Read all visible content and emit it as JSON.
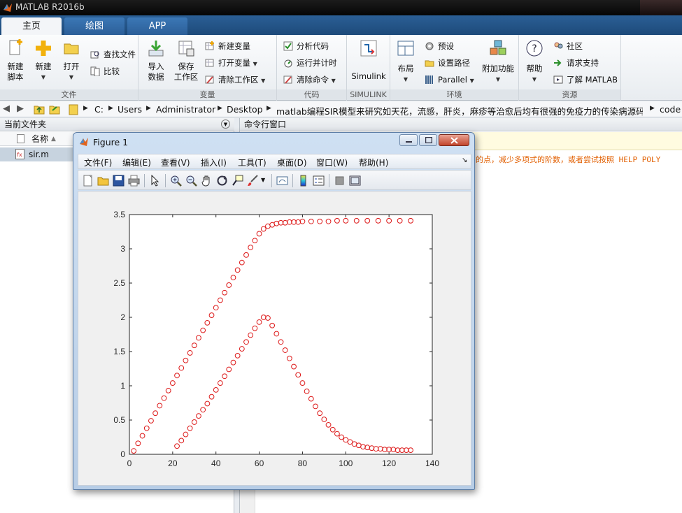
{
  "app": {
    "title": "MATLAB R2016b"
  },
  "tabs": [
    {
      "label": "主页",
      "active": true
    },
    {
      "label": "绘图",
      "active": false
    },
    {
      "label": "APP",
      "active": false
    }
  ],
  "ribbon": {
    "file_group": {
      "label": "文件",
      "new_script": "新建\n脚本",
      "new": "新建",
      "open": "打开",
      "find_files": "查找文件",
      "compare": "比较"
    },
    "variable_group": {
      "label": "变量",
      "import_data": "导入\n数据",
      "save_workspace": "保存\n工作区",
      "new_variable": "新建变量",
      "open_variable": "打开变量",
      "clear_workspace": "清除工作区"
    },
    "code_group": {
      "label": "代码",
      "analyze_code": "分析代码",
      "run_and_time": "运行并计时",
      "clear_commands": "清除命令"
    },
    "simulink_group": {
      "label": "SIMULINK",
      "simulink": "Simulink"
    },
    "env_group": {
      "label": "环境",
      "layout": "布局",
      "preferences": "预设",
      "set_path": "设置路径",
      "parallel": "Parallel",
      "addons": "附加功能"
    },
    "resources_group": {
      "label": "资源",
      "help": "帮助",
      "community": "社区",
      "request_support": "请求支持",
      "learn_matlab": "了解 MATLAB"
    }
  },
  "address": {
    "crumbs": [
      "C:",
      "Users",
      "Administrator",
      "Desktop",
      "matlab编程SIR模型来研究如天花，流感，肝炎，麻疹等治愈后均有很强的免疫力的传染病源码程序",
      "code"
    ]
  },
  "left_panel": {
    "title": "当前文件夹",
    "column_name": "名称",
    "sort_indicator": "▲",
    "files": [
      "sir.m"
    ]
  },
  "right_panel": {
    "title": "命令行窗口",
    "warning_text": "的点，减少多项式的阶数，或者尝试按照 HELP POLY"
  },
  "figure": {
    "title": "Figure 1",
    "menus": [
      "文件(F)",
      "编辑(E)",
      "查看(V)",
      "插入(I)",
      "工具(T)",
      "桌面(D)",
      "窗口(W)",
      "帮助(H)"
    ],
    "toolbar_icons": [
      "new-figure-icon",
      "open-file-icon",
      "save-icon",
      "print-icon",
      "select-arrow-icon",
      "zoom-in-icon",
      "zoom-out-icon",
      "pan-hand-icon",
      "rotate-3d-icon",
      "data-cursor-icon",
      "brush-icon",
      "link-plot-icon",
      "colorbar-icon",
      "legend-icon",
      "hide-tools-icon",
      "show-tools-icon"
    ]
  },
  "chart_data": {
    "type": "scatter",
    "marker": "circle",
    "color": "#dd1a1a",
    "xlim": [
      0,
      140
    ],
    "ylim": [
      0,
      3.5
    ],
    "xticks": [
      0,
      20,
      40,
      60,
      80,
      100,
      120,
      140
    ],
    "yticks": [
      0,
      0.5,
      1,
      1.5,
      2,
      2.5,
      3,
      3.5
    ],
    "series": [
      {
        "x": [
          2,
          4,
          6,
          8,
          10,
          12,
          14,
          16,
          18,
          20,
          22,
          24,
          26,
          28,
          30,
          32,
          34,
          36,
          38,
          40,
          42,
          44,
          46,
          48,
          50,
          52,
          54,
          56,
          58,
          60,
          62,
          64,
          66,
          68,
          70,
          72,
          74,
          76,
          78,
          80,
          84,
          88,
          92,
          96,
          100,
          105,
          110,
          115,
          120,
          125,
          130
        ],
        "y": [
          0.05,
          0.16,
          0.27,
          0.38,
          0.49,
          0.6,
          0.71,
          0.82,
          0.93,
          1.04,
          1.15,
          1.26,
          1.37,
          1.48,
          1.59,
          1.7,
          1.81,
          1.92,
          2.03,
          2.14,
          2.25,
          2.36,
          2.47,
          2.58,
          2.69,
          2.8,
          2.91,
          3.02,
          3.12,
          3.22,
          3.29,
          3.33,
          3.35,
          3.37,
          3.38,
          3.38,
          3.39,
          3.39,
          3.39,
          3.4,
          3.4,
          3.4,
          3.4,
          3.41,
          3.41,
          3.41,
          3.41,
          3.41,
          3.41,
          3.41,
          3.41
        ]
      },
      {
        "x": [
          22,
          24,
          26,
          28,
          30,
          32,
          34,
          36,
          38,
          40,
          42,
          44,
          46,
          48,
          50,
          52,
          54,
          56,
          58,
          60,
          62,
          64,
          66,
          68,
          70,
          72,
          74,
          76,
          78,
          80,
          82,
          84,
          86,
          88,
          90,
          92,
          94,
          96,
          98,
          100,
          102,
          104,
          106,
          108,
          110,
          112,
          114,
          116,
          118,
          120,
          122,
          124,
          126,
          128,
          130
        ],
        "y": [
          0.12,
          0.2,
          0.29,
          0.38,
          0.47,
          0.56,
          0.65,
          0.74,
          0.84,
          0.94,
          1.04,
          1.14,
          1.24,
          1.34,
          1.44,
          1.54,
          1.64,
          1.74,
          1.84,
          1.93,
          2.0,
          1.99,
          1.88,
          1.76,
          1.64,
          1.52,
          1.4,
          1.28,
          1.16,
          1.04,
          0.92,
          0.81,
          0.7,
          0.6,
          0.51,
          0.43,
          0.36,
          0.3,
          0.25,
          0.21,
          0.18,
          0.15,
          0.13,
          0.11,
          0.1,
          0.09,
          0.08,
          0.08,
          0.07,
          0.07,
          0.07,
          0.06,
          0.06,
          0.06,
          0.06
        ]
      }
    ]
  }
}
